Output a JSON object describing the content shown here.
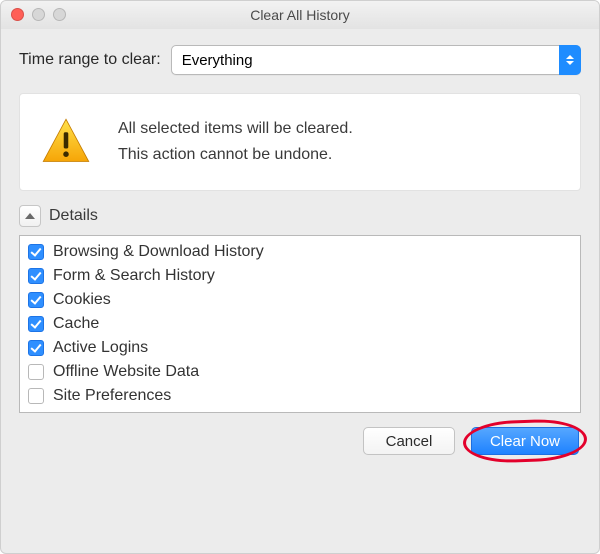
{
  "window": {
    "title": "Clear All History"
  },
  "time_range": {
    "label": "Time range to clear:",
    "selected": "Everything"
  },
  "warning": {
    "line1": "All selected items will be cleared.",
    "line2": "This action cannot be undone."
  },
  "details": {
    "label": "Details",
    "expanded": true,
    "items": [
      {
        "label": "Browsing & Download History",
        "checked": true
      },
      {
        "label": "Form & Search History",
        "checked": true
      },
      {
        "label": "Cookies",
        "checked": true
      },
      {
        "label": "Cache",
        "checked": true
      },
      {
        "label": "Active Logins",
        "checked": true
      },
      {
        "label": "Offline Website Data",
        "checked": false
      },
      {
        "label": "Site Preferences",
        "checked": false
      }
    ]
  },
  "buttons": {
    "cancel": "Cancel",
    "clear_now": "Clear Now"
  },
  "colors": {
    "accent": "#2f8fff",
    "highlight": "#e3002b"
  }
}
